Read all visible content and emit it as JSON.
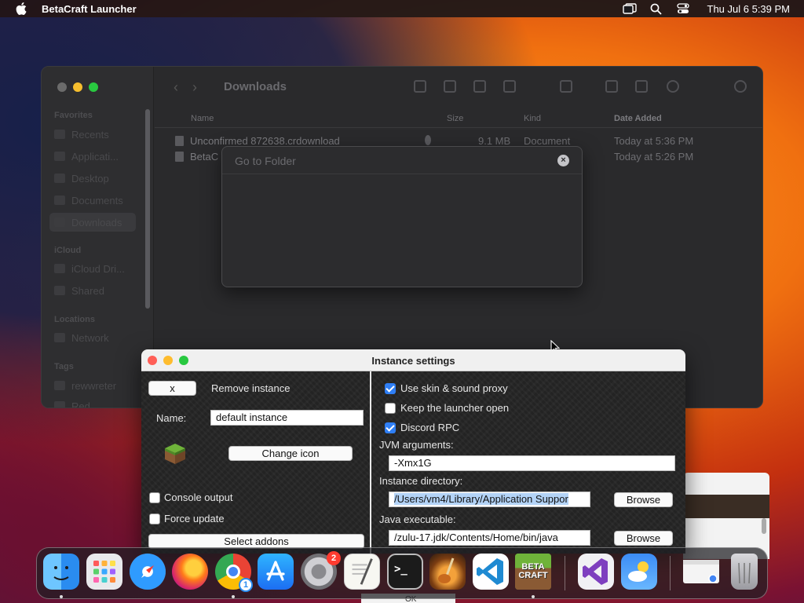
{
  "menubar": {
    "app_name": "BetaCraft Launcher",
    "clock": "Thu Jul 6  5:39 PM"
  },
  "finder": {
    "title": "Downloads",
    "sidebar": {
      "sections": [
        "Favorites",
        "iCloud",
        "Locations",
        "Tags"
      ],
      "favorites": [
        "Recents",
        "Applicati...",
        "Desktop",
        "Documents",
        "Downloads"
      ],
      "icloud": [
        "iCloud Dri...",
        "Shared"
      ],
      "locations": [
        "Network"
      ],
      "tags": [
        "rewwreter",
        "Red"
      ]
    },
    "columns": [
      "Name",
      "Size",
      "Kind",
      "Date Added"
    ],
    "files": [
      {
        "name": "Unconfirmed 872638.crdownload",
        "size": "9.1 MB",
        "kind": "Document",
        "date": "Today at 5:36 PM"
      },
      {
        "name": "BetaC",
        "size": "",
        "kind": "",
        "date": "Today at 5:26 PM"
      }
    ]
  },
  "goto_folder": {
    "title": "Go to Folder"
  },
  "instance_settings": {
    "title": "Instance settings",
    "remove_button": "x",
    "remove_label": "Remove instance",
    "name_label": "Name:",
    "name_value": "default instance",
    "change_icon_button": "Change icon",
    "console_output_label": "Console output",
    "console_output_checked": false,
    "force_update_label": "Force update",
    "force_update_checked": false,
    "select_addons_button": "Select addons",
    "use_skin_label": "Use skin & sound proxy",
    "use_skin_checked": true,
    "keep_open_label": "Keep the launcher open",
    "keep_open_checked": false,
    "discord_rpc_label": "Discord RPC",
    "discord_rpc_checked": true,
    "jvm_label": "JVM arguments:",
    "jvm_value": "-Xmx1G",
    "instance_dir_label": "Instance directory:",
    "instance_dir_value": "/Users/vm4/Library/Application Suppor",
    "browse_button": "Browse",
    "java_exec_label": "Java executable:",
    "java_exec_value": "/zulu-17.jdk/Contents/Home/bin/java",
    "browse_button_2": "Browse"
  },
  "dock": {
    "settings_badge": "2",
    "chrome_badge": "1",
    "betacraft_label_1": "BETA",
    "betacraft_label_2": "CRAFT",
    "terminal_glyph": ">_",
    "ghost_text": "OK"
  },
  "colors": {
    "accent_checkbox": "#2f7ff6",
    "close_red": "#ff5f57",
    "minimize_yellow": "#febc2e",
    "zoom_green": "#28c840",
    "badge_red": "#ff3b30"
  }
}
